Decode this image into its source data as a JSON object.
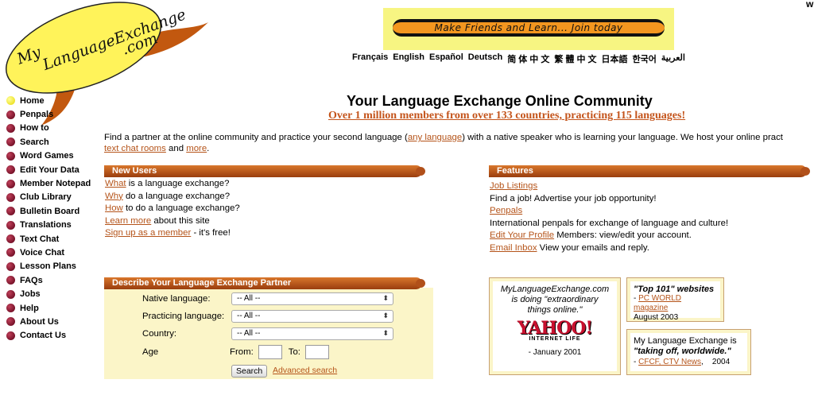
{
  "logo": {
    "line1": "My",
    "line2": "LanguageExchange",
    "line3": ".com"
  },
  "corner_letter": "w",
  "banner": {
    "text": "Make Friends and Learn... Join today"
  },
  "languages": [
    "Français",
    "English",
    "Español",
    "Deutsch",
    "简 体 中 文",
    "繁 體 中 文",
    "日本語",
    "한국어",
    "العربية"
  ],
  "sidebar": {
    "items": [
      {
        "label": "Home"
      },
      {
        "label": "Penpals"
      },
      {
        "label": "How to"
      },
      {
        "label": "Search"
      },
      {
        "label": "Word Games"
      },
      {
        "label": "Edit Your Data"
      },
      {
        "label": "Member Notepad"
      },
      {
        "label": "Club Library"
      },
      {
        "label": "Bulletin Board"
      },
      {
        "label": "Translations"
      },
      {
        "label": "Text Chat"
      },
      {
        "label": "Voice Chat"
      },
      {
        "label": "Lesson Plans"
      },
      {
        "label": "FAQs"
      },
      {
        "label": "Jobs"
      },
      {
        "label": "Help"
      },
      {
        "label": "About Us"
      },
      {
        "label": "Contact Us"
      }
    ]
  },
  "main": {
    "title": "Your Language Exchange Online Community",
    "subtitle": "Over 1 million members from over 133 countries, practicing 115 languages!",
    "intro": {
      "part1": "Find a partner at the online community and practice your second language (",
      "link1": "any language",
      "part2": ") with a native speaker who is learning your language. We host your online pract",
      "link2": "text chat rooms",
      "part3": " and ",
      "link3": "more",
      "part4": "."
    }
  },
  "new_users": {
    "title": "New Users",
    "items": [
      {
        "link": "What",
        "text": " is a language exchange?"
      },
      {
        "link": "Why",
        "text": " do a language exchange?"
      },
      {
        "link": "How",
        "text": " to do a language exchange?"
      },
      {
        "link": "Learn more",
        "text": " about this site"
      },
      {
        "link": "Sign up as a member",
        "text": " - it's free!"
      }
    ]
  },
  "features": {
    "title": "Features",
    "job_link": "Job Listings ",
    "job_text": "Find a job! Advertise your job opportunity!",
    "penpals_link": "Penpals",
    "penpals_text": "International penpals for exchange of language and culture!",
    "profile_link": "Edit Your Profile",
    "profile_text": " Members: view/edit your account.",
    "inbox_link": "Email Inbox",
    "inbox_text": " View your emails and reply."
  },
  "search": {
    "title": "Describe Your Language Exchange Partner",
    "native_label": "Native language:",
    "native_value": "-- All --",
    "practicing_label": "Practicing language:",
    "practicing_value": "-- All --",
    "country_label": "Country:",
    "country_value": "-- All --",
    "age_label": "Age",
    "from_label": "From:",
    "to_label": "To:",
    "button": "Search",
    "advanced": "Advanced search"
  },
  "awards": {
    "yahoo": {
      "line1": "MyLanguageExchange.com",
      "line2": "is doing \"extraordinary",
      "line3": "things online.\"",
      "logo": "YAHOO!",
      "logo_sub": "INTERNET LIFE",
      "date": "- January 2001"
    },
    "top101": {
      "title": "\"Top 101\" websites",
      "dash": "- ",
      "source": "PC WORLD magazine",
      "date": "August 2003"
    },
    "cfcf": {
      "line1": "My Language Exchange is",
      "line2": "\"taking off, worldwide.\"",
      "dash": "- ",
      "source": "CFCF, CTV News",
      "date": ",    2004"
    }
  }
}
